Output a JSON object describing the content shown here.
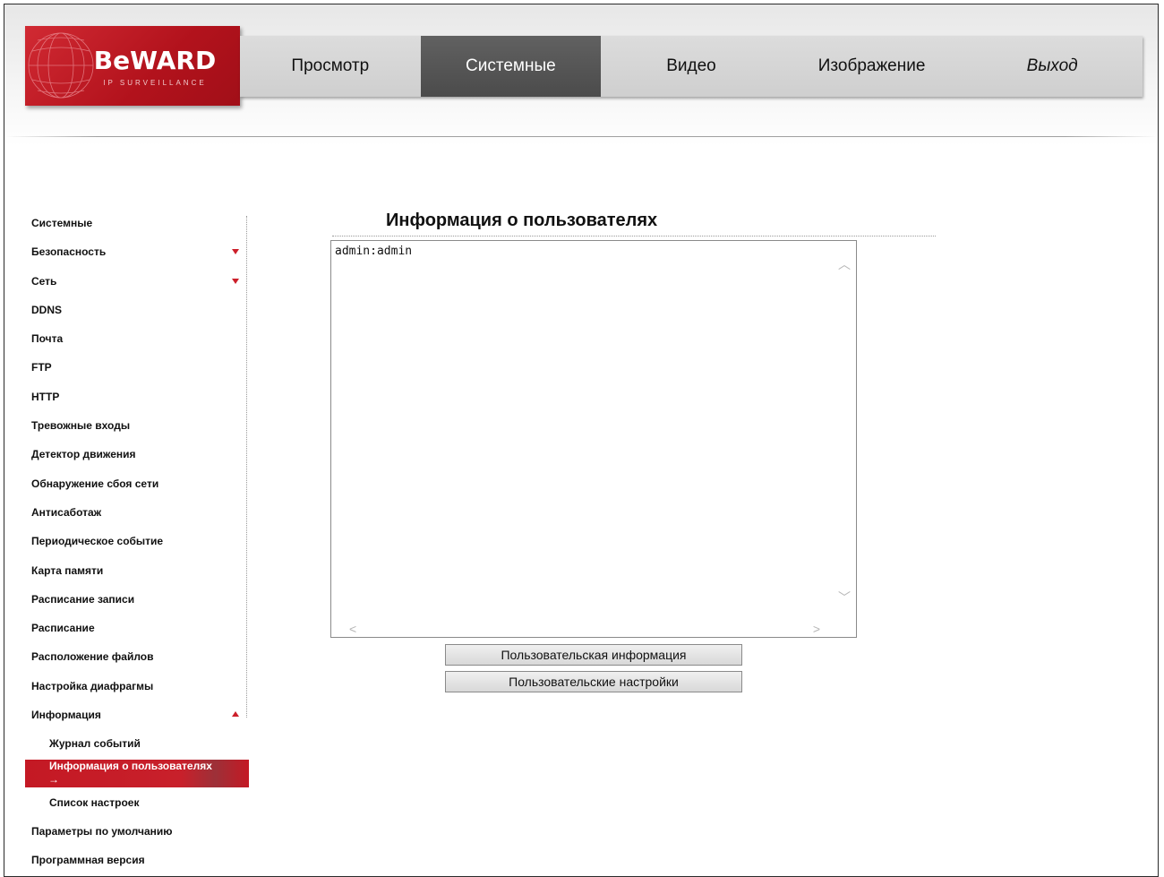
{
  "brand": {
    "logo_text": "BeWARD",
    "logo_sub": "IP SURVEILLANCE",
    "accent": "#c41924"
  },
  "topnav": {
    "tabs": [
      {
        "label": "Просмотр"
      },
      {
        "label": "Системные",
        "active": true
      },
      {
        "label": "Видео"
      },
      {
        "label": "Изображение"
      },
      {
        "label": "Выход"
      }
    ]
  },
  "sidebar": {
    "items": [
      {
        "label": "Системные"
      },
      {
        "label": "Безопасность",
        "arrow": "down"
      },
      {
        "label": "Сеть",
        "arrow": "down"
      },
      {
        "label": "DDNS"
      },
      {
        "label": "Почта"
      },
      {
        "label": "FTP"
      },
      {
        "label": "HTTP"
      },
      {
        "label": "Тревожные входы"
      },
      {
        "label": "Детектор движения"
      },
      {
        "label": "Обнаружение сбоя сети"
      },
      {
        "label": "Антисаботаж"
      },
      {
        "label": "Периодическое событие"
      },
      {
        "label": "Карта памяти"
      },
      {
        "label": "Расписание записи"
      },
      {
        "label": "Расписание"
      },
      {
        "label": "Расположение файлов"
      },
      {
        "label": "Настройка диафрагмы"
      },
      {
        "label": "Информация",
        "arrow": "up"
      },
      {
        "label": "Журнал событий"
      },
      {
        "label": "Информация о пользователях",
        "selected_marker": "→"
      },
      {
        "label": "Список настроек"
      },
      {
        "label": "Параметры по умолчанию"
      },
      {
        "label": "Программная версия"
      }
    ]
  },
  "main": {
    "title": "Информация о пользователях",
    "textbox_content": "admin:admin",
    "buttons": {
      "user_info": "Пользовательская информация",
      "user_settings": "Пользовательские настройки"
    }
  }
}
